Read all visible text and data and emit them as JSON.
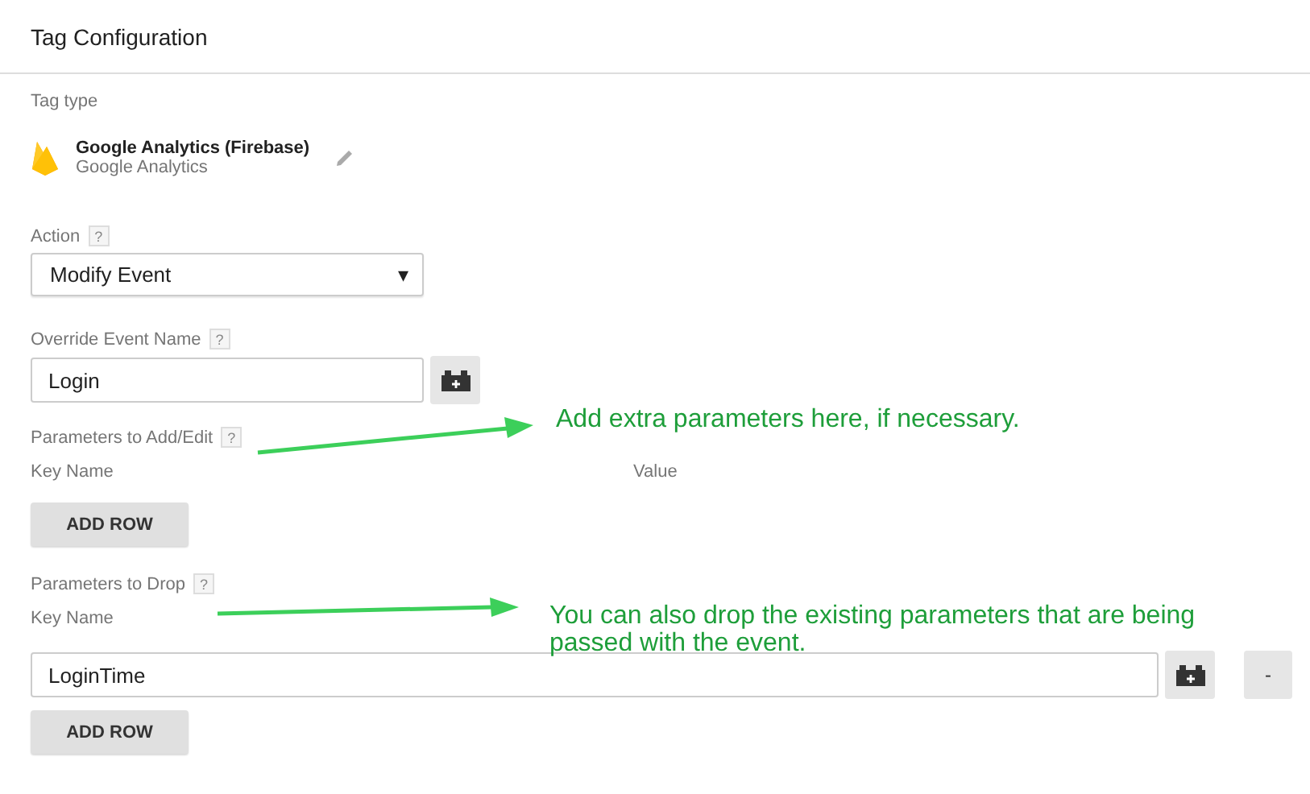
{
  "header": {
    "title": "Tag Configuration"
  },
  "tag_type": {
    "label": "Tag type",
    "name": "Google Analytics (Firebase)",
    "subtitle": "Google Analytics"
  },
  "action": {
    "label": "Action",
    "help": "?",
    "value": "Modify Event",
    "caret": "▾"
  },
  "override_event_name": {
    "label": "Override Event Name",
    "help": "?",
    "value": "Login"
  },
  "parameters_to_add": {
    "label": "Parameters to Add/Edit",
    "help": "?",
    "columns": [
      "Key Name",
      "Value"
    ],
    "add_button": "ADD ROW"
  },
  "parameters_to_drop": {
    "label": "Parameters to Drop",
    "help": "?",
    "columns": [
      "Key Name"
    ],
    "rows": [
      {
        "value": "LoginTime",
        "remove": "-"
      }
    ],
    "add_button": "ADD ROW"
  },
  "annotations": [
    {
      "text": "Add extra parameters here, if necessary."
    },
    {
      "text": "You can also drop the existing parameters that are being passed with the event."
    }
  ]
}
